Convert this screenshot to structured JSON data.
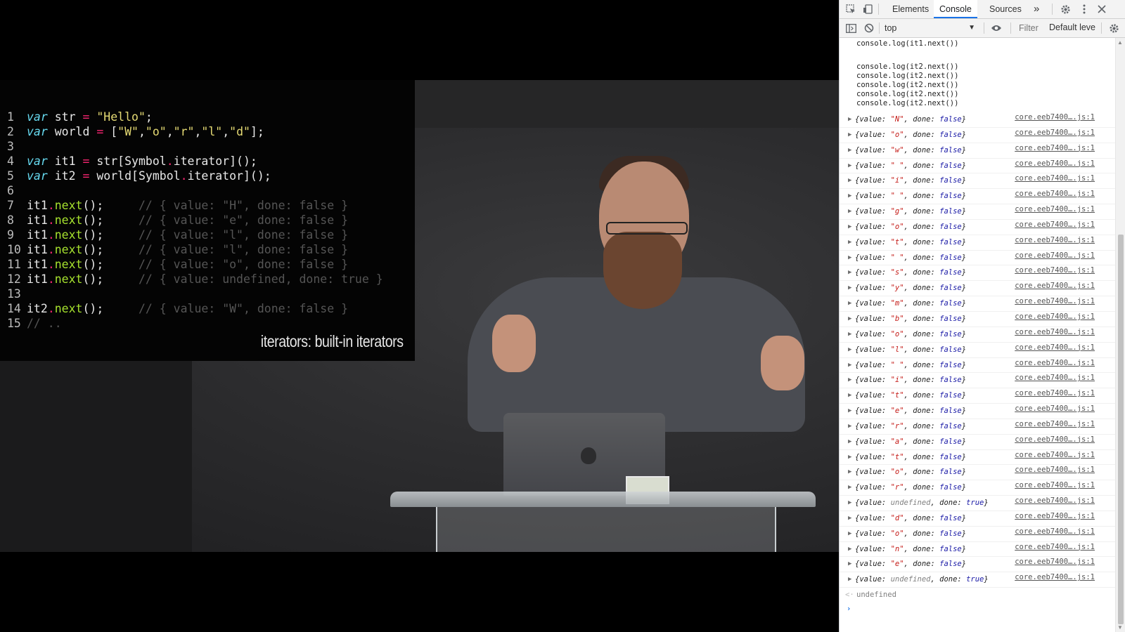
{
  "slide": {
    "lines": [
      {
        "n": "1",
        "parts": [
          {
            "t": "var",
            "c": "kw"
          },
          {
            "t": " str ",
            "c": ""
          },
          {
            "t": "=",
            "c": "op"
          },
          {
            "t": " ",
            "c": ""
          },
          {
            "t": "\"Hello\"",
            "c": "st"
          },
          {
            "t": ";",
            "c": ""
          }
        ]
      },
      {
        "n": "2",
        "parts": [
          {
            "t": "var",
            "c": "kw"
          },
          {
            "t": " world ",
            "c": ""
          },
          {
            "t": "=",
            "c": "op"
          },
          {
            "t": " [",
            "c": ""
          },
          {
            "t": "\"W\"",
            "c": "st"
          },
          {
            "t": ",",
            "c": ""
          },
          {
            "t": "\"o\"",
            "c": "st"
          },
          {
            "t": ",",
            "c": ""
          },
          {
            "t": "\"r\"",
            "c": "st"
          },
          {
            "t": ",",
            "c": ""
          },
          {
            "t": "\"l\"",
            "c": "st"
          },
          {
            "t": ",",
            "c": ""
          },
          {
            "t": "\"d\"",
            "c": "st"
          },
          {
            "t": "];",
            "c": ""
          }
        ]
      },
      {
        "n": "3",
        "parts": []
      },
      {
        "n": "4",
        "parts": [
          {
            "t": "var",
            "c": "kw"
          },
          {
            "t": " it1 ",
            "c": ""
          },
          {
            "t": "=",
            "c": "op"
          },
          {
            "t": " str[Symbol",
            "c": ""
          },
          {
            "t": ".",
            "c": "op"
          },
          {
            "t": "iterator]();",
            "c": ""
          }
        ]
      },
      {
        "n": "5",
        "parts": [
          {
            "t": "var",
            "c": "kw"
          },
          {
            "t": " it2 ",
            "c": ""
          },
          {
            "t": "=",
            "c": "op"
          },
          {
            "t": " world[Symbol",
            "c": ""
          },
          {
            "t": ".",
            "c": "op"
          },
          {
            "t": "iterator]();",
            "c": ""
          }
        ]
      },
      {
        "n": "6",
        "parts": []
      },
      {
        "n": "7",
        "parts": [
          {
            "t": "it1",
            "c": ""
          },
          {
            "t": ".",
            "c": "op"
          },
          {
            "t": "next",
            "c": "fn"
          },
          {
            "t": "();     ",
            "c": ""
          },
          {
            "t": "// { value: \"H\", done: false }",
            "c": "cm"
          }
        ]
      },
      {
        "n": "8",
        "parts": [
          {
            "t": "it1",
            "c": ""
          },
          {
            "t": ".",
            "c": "op"
          },
          {
            "t": "next",
            "c": "fn"
          },
          {
            "t": "();     ",
            "c": ""
          },
          {
            "t": "// { value: \"e\", done: false }",
            "c": "cm"
          }
        ]
      },
      {
        "n": "9",
        "parts": [
          {
            "t": "it1",
            "c": ""
          },
          {
            "t": ".",
            "c": "op"
          },
          {
            "t": "next",
            "c": "fn"
          },
          {
            "t": "();     ",
            "c": ""
          },
          {
            "t": "// { value: \"l\", done: false }",
            "c": "cm"
          }
        ]
      },
      {
        "n": "10",
        "parts": [
          {
            "t": "it1",
            "c": ""
          },
          {
            "t": ".",
            "c": "op"
          },
          {
            "t": "next",
            "c": "fn"
          },
          {
            "t": "();     ",
            "c": ""
          },
          {
            "t": "// { value: \"l\", done: false }",
            "c": "cm"
          }
        ]
      },
      {
        "n": "11",
        "parts": [
          {
            "t": "it1",
            "c": ""
          },
          {
            "t": ".",
            "c": "op"
          },
          {
            "t": "next",
            "c": "fn"
          },
          {
            "t": "();     ",
            "c": ""
          },
          {
            "t": "// { value: \"o\", done: false }",
            "c": "cm"
          }
        ]
      },
      {
        "n": "12",
        "parts": [
          {
            "t": "it1",
            "c": ""
          },
          {
            "t": ".",
            "c": "op"
          },
          {
            "t": "next",
            "c": "fn"
          },
          {
            "t": "();     ",
            "c": ""
          },
          {
            "t": "// { value: undefined, done: true }",
            "c": "cm"
          }
        ]
      },
      {
        "n": "13",
        "parts": []
      },
      {
        "n": "14",
        "parts": [
          {
            "t": "it2",
            "c": ""
          },
          {
            "t": ".",
            "c": "op"
          },
          {
            "t": "next",
            "c": "fn"
          },
          {
            "t": "();     ",
            "c": ""
          },
          {
            "t": "// { value: \"W\", done: false }",
            "c": "cm"
          }
        ]
      },
      {
        "n": "15",
        "parts": [
          {
            "t": "// ..",
            "c": "cm"
          }
        ]
      }
    ],
    "caption": "iterators: built-in iterators"
  },
  "devtools": {
    "tabs": [
      {
        "label": "Elements",
        "active": false
      },
      {
        "label": "Console",
        "active": true
      },
      {
        "label": "Sources",
        "active": false
      }
    ],
    "more_tabs": "»",
    "context": "top",
    "filter_placeholder": "Filter",
    "levels": "Default leve",
    "source_top": "console.log(it1.next())",
    "source_block": [
      "console.log(it2.next())",
      "console.log(it2.next())",
      "console.log(it2.next())",
      "console.log(it2.next())",
      "console.log(it2.next())"
    ],
    "link_text": "core.eeb7400….js:1",
    "entries": [
      {
        "value": "\"N\"",
        "done": "false"
      },
      {
        "value": "\"o\"",
        "done": "false"
      },
      {
        "value": "\"w\"",
        "done": "false"
      },
      {
        "value": "\" \"",
        "done": "false"
      },
      {
        "value": "\"i\"",
        "done": "false"
      },
      {
        "value": "\" \"",
        "done": "false"
      },
      {
        "value": "\"g\"",
        "done": "false"
      },
      {
        "value": "\"o\"",
        "done": "false"
      },
      {
        "value": "\"t\"",
        "done": "false"
      },
      {
        "value": "\" \"",
        "done": "false"
      },
      {
        "value": "\"s\"",
        "done": "false"
      },
      {
        "value": "\"y\"",
        "done": "false"
      },
      {
        "value": "\"m\"",
        "done": "false"
      },
      {
        "value": "\"b\"",
        "done": "false"
      },
      {
        "value": "\"o\"",
        "done": "false"
      },
      {
        "value": "\"l\"",
        "done": "false"
      },
      {
        "value": "\" \"",
        "done": "false"
      },
      {
        "value": "\"i\"",
        "done": "false"
      },
      {
        "value": "\"t\"",
        "done": "false"
      },
      {
        "value": "\"e\"",
        "done": "false"
      },
      {
        "value": "\"r\"",
        "done": "false"
      },
      {
        "value": "\"a\"",
        "done": "false"
      },
      {
        "value": "\"t\"",
        "done": "false"
      },
      {
        "value": "\"o\"",
        "done": "false"
      },
      {
        "value": "\"r\"",
        "done": "false"
      },
      {
        "value": "undefined",
        "done": "true"
      },
      {
        "value": "\"d\"",
        "done": "false"
      },
      {
        "value": "\"o\"",
        "done": "false"
      },
      {
        "value": "\"n\"",
        "done": "false"
      },
      {
        "value": "\"e\"",
        "done": "false"
      },
      {
        "value": "undefined",
        "done": "true"
      }
    ],
    "result_text": "undefined",
    "prompt_symbol": "›"
  }
}
